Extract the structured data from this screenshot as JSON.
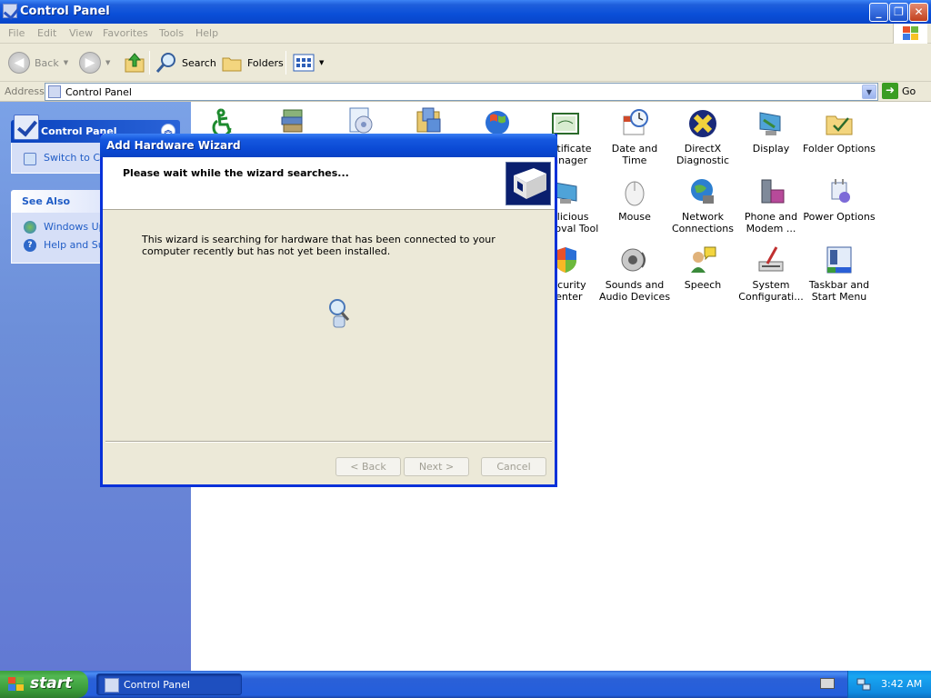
{
  "window": {
    "title": "Control Panel"
  },
  "menu": [
    "File",
    "Edit",
    "View",
    "Favorites",
    "Tools",
    "Help"
  ],
  "toolbar": {
    "back": "Back",
    "search": "Search",
    "folders": "Folders"
  },
  "address": {
    "label": "Address",
    "value": "Control Panel",
    "go": "Go"
  },
  "left_pane": {
    "control_panel_title": "Control Panel",
    "switch_link": "Switch to Category View",
    "see_also_title": "See Also",
    "see_also": [
      "Windows Update",
      "Help and Support"
    ]
  },
  "items": [
    {
      "label": "Certificate Manager",
      "icon": "certificate-icon"
    },
    {
      "label": "Date and Time",
      "icon": "clock-icon"
    },
    {
      "label": "DirectX Diagnostic",
      "icon": "directx-icon"
    },
    {
      "label": "Display",
      "icon": "display-icon"
    },
    {
      "label": "Folder Options",
      "icon": "folder-options-icon"
    },
    {
      "label": "Malicious Removal Tool",
      "icon": "malicious-tool-icon"
    },
    {
      "label": "Mouse",
      "icon": "mouse-icon"
    },
    {
      "label": "Network Connections",
      "icon": "network-icon"
    },
    {
      "label": "Phone and Modem ...",
      "icon": "phone-icon"
    },
    {
      "label": "Power Options",
      "icon": "power-icon"
    },
    {
      "label": "Security Center",
      "icon": "shield-icon"
    },
    {
      "label": "Sounds and Audio Devices",
      "icon": "speaker-icon"
    },
    {
      "label": "Speech",
      "icon": "speech-icon"
    },
    {
      "label": "System Configurati...",
      "icon": "system-icon"
    },
    {
      "label": "Taskbar and Start Menu",
      "icon": "taskbar-icon"
    }
  ],
  "wizard": {
    "title": "Add Hardware Wizard",
    "heading": "Please wait while the wizard searches...",
    "body": "This wizard is searching for hardware that has been connected to your computer recently but has not yet been installed.",
    "back": "< Back",
    "next": "Next >",
    "cancel": "Cancel"
  },
  "taskbar": {
    "start": "start",
    "task": "Control Panel",
    "clock": "3:42 AM"
  },
  "colors": {
    "title_blue": "#0a4fd8",
    "left_pane": "#6d8fd9",
    "wizard_border": "#0831d9",
    "start_green": "#3a9b3a"
  }
}
